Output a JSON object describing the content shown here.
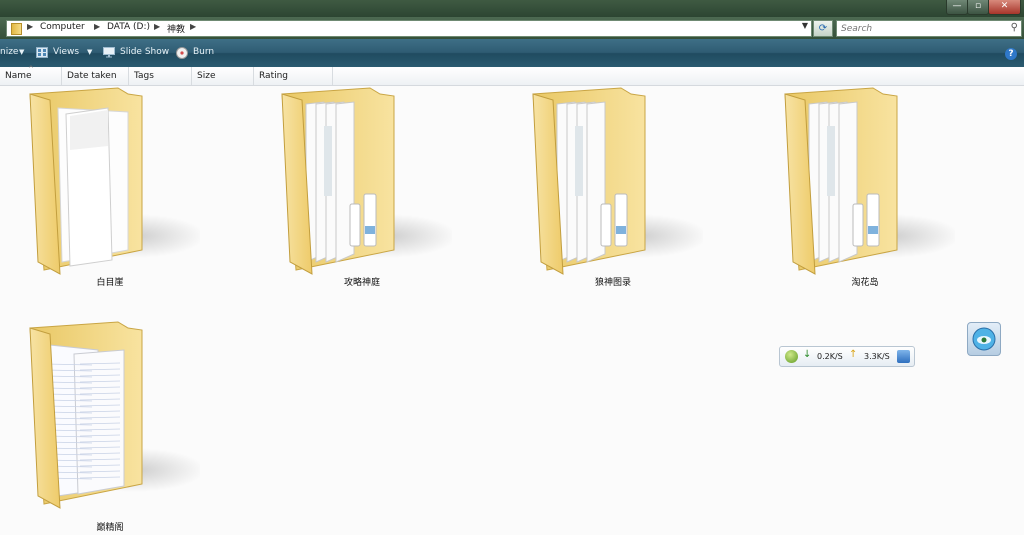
{
  "window": {
    "min_glyph": "—",
    "max_glyph": "▫",
    "close_glyph": "✕"
  },
  "address_bar": {
    "crumbs": [
      "Computer",
      "DATA (D:)",
      "神教"
    ],
    "search_placeholder": "Search"
  },
  "toolbar": {
    "organize_label": "nize",
    "views_label": "Views",
    "slideshow_label": "Slide Show",
    "burn_label": "Burn",
    "help_glyph": "?"
  },
  "columns": [
    "Name",
    "Date taken",
    "Tags",
    "Size",
    "Rating"
  ],
  "folders": [
    {
      "name": "白目崖",
      "style": "documents"
    },
    {
      "name": "攻略神庭",
      "style": "books"
    },
    {
      "name": "狼神图录",
      "style": "books"
    },
    {
      "name": "淘花岛",
      "style": "books"
    },
    {
      "name": "巅精阁",
      "style": "notes"
    }
  ],
  "speed_widget": {
    "down": "0.2K/S",
    "up": "3.3K/S"
  },
  "icons": {
    "folder": "folder-icon",
    "refresh": "refresh-icon",
    "search": "search-icon",
    "views": "views-icon",
    "slideshow": "slideshow-icon",
    "burn": "burn-icon",
    "help": "help-icon"
  },
  "colors": {
    "title_bar": "#3f5a42",
    "command_bar": "#2f5c73",
    "folder_yellow": "#f3d77f"
  }
}
